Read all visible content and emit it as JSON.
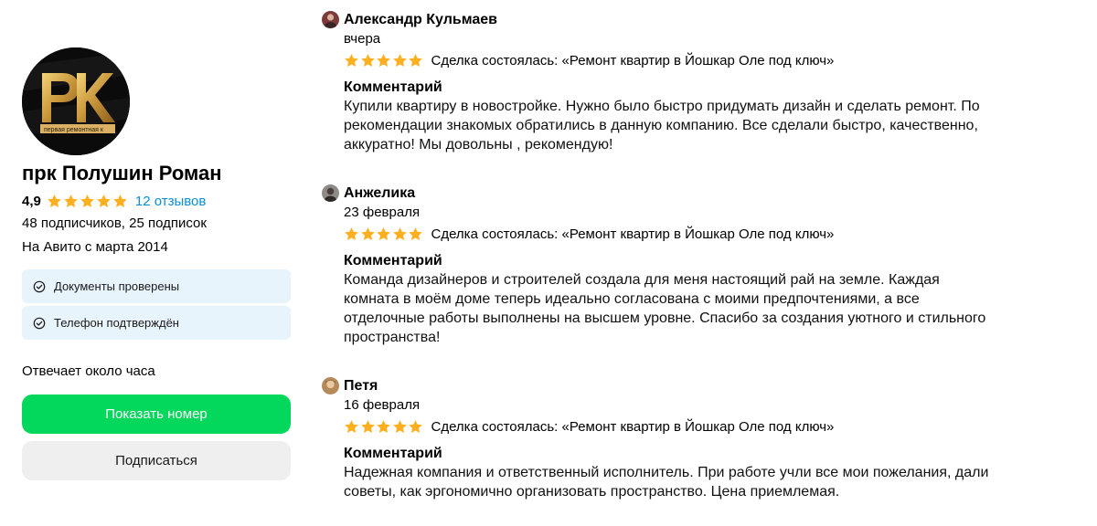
{
  "profile": {
    "logo_text": "PK",
    "logo_tagline": "первая ремонтная к",
    "name": "прк Полушин Роман",
    "rating": "4,9",
    "rating_stars": 5,
    "reviews_link": "12 отзывов",
    "followers": "48 подписчиков, 25 подписок",
    "since": "На Авито с марта 2014",
    "verifications": [
      "Документы проверены",
      "Телефон подтверждён"
    ],
    "response_time": "Отвечает около часа",
    "show_phone_label": "Показать номер",
    "subscribe_label": "Подписаться"
  },
  "colors": {
    "accent_green": "#04d85c",
    "star_gold": "#ffb021",
    "link_blue": "#0a8ed6",
    "verify_bg": "#e8f4fb"
  },
  "reviews": [
    {
      "author": "Александр Кульмаев",
      "date": "вчера",
      "stars": 5,
      "deal": "Сделка состоялась: «Ремонт квартир в Йошкар Оле под ключ»",
      "comment_title": "Комментарий",
      "comment": "Купили квартиру в новостройке. Нужно было быстро придумать дизайн и сделать ремонт. По рекомендации знакомых обратились в данную компанию. Все сделали быстро, качественно, аккуратно! Мы довольны , рекомендую!"
    },
    {
      "author": "Анжелика",
      "date": "23 февраля",
      "stars": 5,
      "deal": "Сделка состоялась: «Ремонт квартир в Йошкар Оле под ключ»",
      "comment_title": "Комментарий",
      "comment": "Команда дизайнеров и строителей создала для меня настоящий рай на земле. Каждая комната в моём доме теперь идеально согласована с моими предпочтениями, а все отделочные работы выполнены на высшем уровне. Спасибо за создания уютного и стильного пространства!"
    },
    {
      "author": "Петя",
      "date": "16 февраля",
      "stars": 5,
      "deal": "Сделка состоялась: «Ремонт квартир в Йошкар Оле под ключ»",
      "comment_title": "Комментарий",
      "comment": "Надежная компания и ответственный исполнитель. При работе учли все мои пожелания, дали советы, как эргономично организовать пространство. Цена приемлемая."
    }
  ]
}
